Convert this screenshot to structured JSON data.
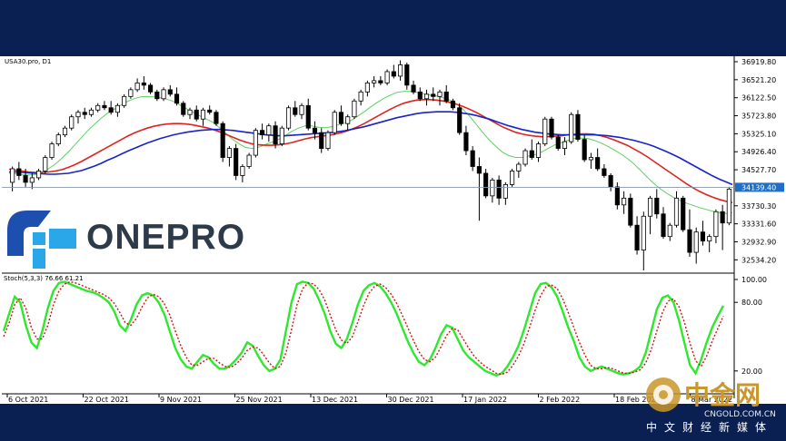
{
  "chart_data": {
    "type": "candlestick",
    "symbol_label": "USA30.pro, D1",
    "x_labels": [
      "6 Oct 2021",
      "22 Oct 2021",
      "9 Nov 2021",
      "25 Nov 2021",
      "13 Dec 2021",
      "30 Dec 2021",
      "17 Jan 2022",
      "2 Feb 2022",
      "18 Feb 2022",
      "8 Mar 2022"
    ],
    "y_ticks": [
      36919.8,
      36521.2,
      36122.5,
      35723.8,
      35325.1,
      34926.4,
      34527.7,
      33730.3,
      33331.6,
      32932.9,
      32534.2
    ],
    "current_price": "34139.40",
    "ylim": [
      32300,
      37000
    ],
    "candles": [
      [
        34250,
        34600,
        34050,
        34550
      ],
      [
        34550,
        34700,
        34300,
        34400
      ],
      [
        34400,
        34550,
        34150,
        34250
      ],
      [
        34250,
        34450,
        34100,
        34350
      ],
      [
        34350,
        34550,
        34300,
        34500
      ],
      [
        34500,
        34850,
        34450,
        34800
      ],
      [
        34800,
        35150,
        34750,
        35100
      ],
      [
        35100,
        35350,
        35050,
        35300
      ],
      [
        35300,
        35500,
        35250,
        35450
      ],
      [
        35450,
        35750,
        35400,
        35700
      ],
      [
        35700,
        35850,
        35550,
        35800
      ],
      [
        35800,
        35900,
        35650,
        35750
      ],
      [
        35750,
        35900,
        35700,
        35850
      ],
      [
        35850,
        36000,
        35800,
        35950
      ],
      [
        35950,
        36050,
        35850,
        35900
      ],
      [
        35900,
        36050,
        35750,
        35800
      ],
      [
        35800,
        36000,
        35700,
        35950
      ],
      [
        35950,
        36200,
        35900,
        36150
      ],
      [
        36150,
        36350,
        36100,
        36300
      ],
      [
        36300,
        36550,
        36250,
        36450
      ],
      [
        36450,
        36600,
        36300,
        36400
      ],
      [
        36400,
        36450,
        36200,
        36250
      ],
      [
        36250,
        36300,
        36050,
        36100
      ],
      [
        36100,
        36350,
        36050,
        36300
      ],
      [
        36300,
        36400,
        36150,
        36200
      ],
      [
        36200,
        36350,
        35950,
        36000
      ],
      [
        36000,
        36050,
        35700,
        35750
      ],
      [
        35750,
        35900,
        35650,
        35850
      ],
      [
        35850,
        35950,
        35600,
        35650
      ],
      [
        35650,
        35900,
        35500,
        35850
      ],
      [
        35850,
        35950,
        35750,
        35800
      ],
      [
        35800,
        35850,
        35500,
        35550
      ],
      [
        35550,
        35600,
        34700,
        34800
      ],
      [
        34800,
        35050,
        34600,
        35000
      ],
      [
        35000,
        35100,
        34300,
        34400
      ],
      [
        34400,
        34650,
        34250,
        34600
      ],
      [
        34600,
        34900,
        34550,
        34850
      ],
      [
        34850,
        35450,
        34800,
        35400
      ],
      [
        35400,
        35550,
        35200,
        35300
      ],
      [
        35300,
        35550,
        35150,
        35500
      ],
      [
        35500,
        35600,
        35000,
        35100
      ],
      [
        35100,
        35500,
        35050,
        35450
      ],
      [
        35450,
        35950,
        35400,
        35900
      ],
      [
        35900,
        36050,
        35700,
        35750
      ],
      [
        35750,
        36000,
        35650,
        35950
      ],
      [
        35950,
        36100,
        35400,
        35450
      ],
      [
        35450,
        35600,
        35200,
        35350
      ],
      [
        35350,
        35450,
        34900,
        35000
      ],
      [
        35000,
        35400,
        34950,
        35350
      ],
      [
        35350,
        35850,
        35300,
        35800
      ],
      [
        35800,
        35950,
        35500,
        35550
      ],
      [
        35550,
        35750,
        35400,
        35700
      ],
      [
        35700,
        36100,
        35650,
        36050
      ],
      [
        36050,
        36300,
        35950,
        36250
      ],
      [
        36250,
        36500,
        36150,
        36450
      ],
      [
        36450,
        36600,
        36350,
        36500
      ],
      [
        36500,
        36600,
        36400,
        36450
      ],
      [
        36450,
        36750,
        36400,
        36700
      ],
      [
        36700,
        36850,
        36550,
        36600
      ],
      [
        36600,
        36950,
        36500,
        36850
      ],
      [
        36850,
        36900,
        36300,
        36400
      ],
      [
        36400,
        36500,
        36200,
        36250
      ],
      [
        36250,
        36350,
        36050,
        36100
      ],
      [
        36100,
        36300,
        35950,
        36200
      ],
      [
        36200,
        36350,
        36050,
        36150
      ],
      [
        36150,
        36300,
        35950,
        36250
      ],
      [
        36250,
        36400,
        36000,
        36050
      ],
      [
        36050,
        36100,
        35850,
        35900
      ],
      [
        35900,
        36000,
        35300,
        35350
      ],
      [
        35350,
        35500,
        34850,
        34950
      ],
      [
        34950,
        35050,
        34500,
        34600
      ],
      [
        34600,
        34800,
        33400,
        34450
      ],
      [
        34450,
        34550,
        33900,
        33950
      ],
      [
        33950,
        34350,
        33800,
        34300
      ],
      [
        34300,
        34400,
        33750,
        33900
      ],
      [
        33900,
        34250,
        33750,
        34200
      ],
      [
        34200,
        34550,
        34150,
        34500
      ],
      [
        34500,
        34700,
        34350,
        34650
      ],
      [
        34650,
        35000,
        34600,
        34950
      ],
      [
        34950,
        35200,
        34750,
        34800
      ],
      [
        34800,
        35150,
        34700,
        35100
      ],
      [
        35100,
        35700,
        35050,
        35650
      ],
      [
        35650,
        35700,
        35200,
        35250
      ],
      [
        35250,
        35300,
        34950,
        35000
      ],
      [
        35000,
        35250,
        34850,
        35150
      ],
      [
        35150,
        35800,
        35100,
        35750
      ],
      [
        35750,
        35850,
        35150,
        35200
      ],
      [
        35200,
        35300,
        34700,
        34750
      ],
      [
        34750,
        34900,
        34550,
        34800
      ],
      [
        34800,
        35000,
        34500,
        34550
      ],
      [
        34550,
        34650,
        34350,
        34400
      ],
      [
        34400,
        34450,
        34050,
        34150
      ],
      [
        34150,
        34250,
        33650,
        33750
      ],
      [
        33750,
        34050,
        33550,
        33900
      ],
      [
        33900,
        34000,
        33250,
        33300
      ],
      [
        33300,
        33500,
        32650,
        32750
      ],
      [
        32750,
        33600,
        32300,
        33500
      ],
      [
        33500,
        33950,
        33100,
        33900
      ],
      [
        33900,
        34100,
        33450,
        33550
      ],
      [
        33550,
        33700,
        33000,
        33050
      ],
      [
        33050,
        33350,
        32950,
        33300
      ],
      [
        33300,
        34050,
        33250,
        33900
      ],
      [
        33900,
        33950,
        33150,
        33200
      ],
      [
        33200,
        33650,
        32600,
        32700
      ],
      [
        32700,
        33250,
        32450,
        33150
      ],
      [
        33150,
        33400,
        32850,
        32950
      ],
      [
        32950,
        33100,
        32700,
        33050
      ],
      [
        33050,
        33650,
        32900,
        33600
      ],
      [
        33600,
        33750,
        32750,
        33350
      ],
      [
        33350,
        34150,
        33300,
        34100
      ]
    ],
    "ma_green": [
      34450,
      34440,
      34420,
      34410,
      34420,
      34470,
      34550,
      34650,
      34780,
      34920,
      35080,
      35240,
      35400,
      35540,
      35670,
      35780,
      35870,
      35960,
      36040,
      36100,
      36140,
      36150,
      36140,
      36120,
      36090,
      36040,
      35960,
      35880,
      35800,
      35720,
      35650,
      35580,
      35460,
      35330,
      35200,
      35100,
      35020,
      35000,
      35030,
      35090,
      35140,
      35200,
      35280,
      35380,
      35450,
      35500,
      35500,
      35470,
      35460,
      35480,
      35520,
      35560,
      35620,
      35710,
      35810,
      35920,
      36020,
      36110,
      36180,
      36240,
      36260,
      36260,
      36240,
      36210,
      36180,
      36160,
      36120,
      36070,
      35990,
      35870,
      35720,
      35540,
      35360,
      35190,
      35050,
      34920,
      34840,
      34800,
      34800,
      34830,
      34860,
      34920,
      35000,
      35080,
      35130,
      35180,
      35220,
      35230,
      35220,
      35180,
      35120,
      35050,
      34970,
      34880,
      34780,
      34660,
      34520,
      34370,
      34230,
      34110,
      34010,
      33920,
      33850,
      33790,
      33740,
      33690,
      33650,
      33610,
      33580,
      33560,
      33580
    ],
    "ma_red": [
      34540,
      34520,
      34500,
      34480,
      34470,
      34470,
      34480,
      34500,
      34530,
      34580,
      34640,
      34710,
      34790,
      34870,
      34950,
      35030,
      35110,
      35190,
      35270,
      35340,
      35400,
      35450,
      35490,
      35520,
      35540,
      35550,
      35550,
      35540,
      35520,
      35490,
      35460,
      35420,
      35370,
      35310,
      35250,
      35190,
      35140,
      35100,
      35080,
      35070,
      35070,
      35080,
      35100,
      35130,
      35170,
      35210,
      35240,
      35260,
      35280,
      35300,
      35330,
      35370,
      35420,
      35480,
      35550,
      35630,
      35710,
      35790,
      35870,
      35940,
      36000,
      36040,
      36070,
      36080,
      36080,
      36070,
      36050,
      36020,
      35980,
      35930,
      35870,
      35800,
      35720,
      35640,
      35560,
      35480,
      35420,
      35360,
      35320,
      35290,
      35270,
      35260,
      35260,
      35270,
      35280,
      35300,
      35310,
      35320,
      35320,
      35310,
      35280,
      35240,
      35190,
      35130,
      35070,
      34990,
      34910,
      34820,
      34720,
      34620,
      34520,
      34420,
      34320,
      34220,
      34130,
      34050,
      33980,
      33920,
      33870,
      33830,
      33800
    ],
    "ma_blue": [
      34480,
      34480,
      34470,
      34460,
      34450,
      34440,
      34430,
      34430,
      34440,
      34450,
      34480,
      34510,
      34560,
      34610,
      34670,
      34740,
      34800,
      34870,
      34940,
      35000,
      35060,
      35120,
      35170,
      35220,
      35260,
      35300,
      35330,
      35360,
      35380,
      35400,
      35410,
      35420,
      35420,
      35410,
      35400,
      35380,
      35360,
      35340,
      35320,
      35300,
      35290,
      35280,
      35280,
      35290,
      35300,
      35310,
      35320,
      35330,
      35340,
      35350,
      35370,
      35390,
      35420,
      35450,
      35480,
      35520,
      35560,
      35600,
      35640,
      35680,
      35710,
      35740,
      35770,
      35790,
      35800,
      35810,
      35810,
      35810,
      35800,
      35780,
      35760,
      35730,
      35690,
      35650,
      35600,
      35550,
      35500,
      35460,
      35420,
      35390,
      35360,
      35340,
      35320,
      35310,
      35300,
      35300,
      35300,
      35300,
      35300,
      35300,
      35290,
      35280,
      35260,
      35240,
      35210,
      35180,
      35140,
      35100,
      35050,
      34990,
      34930,
      34860,
      34790,
      34710,
      34630,
      34550,
      34470,
      34390,
      34320,
      34260,
      34200
    ],
    "stochastic": {
      "label": "Stoch(5,3,3) 76.66 61.21",
      "y_ticks": [
        100,
        80,
        20
      ],
      "k_last": 76.66,
      "d_last": 61.21,
      "k": [
        55,
        70,
        85,
        80,
        60,
        45,
        40,
        55,
        75,
        90,
        97,
        98,
        96,
        94,
        92,
        90,
        89,
        87,
        84,
        80,
        72,
        60,
        55,
        65,
        78,
        86,
        88,
        86,
        80,
        70,
        55,
        40,
        30,
        24,
        22,
        28,
        34,
        32,
        26,
        22,
        22,
        25,
        30,
        36,
        45,
        42,
        33,
        25,
        20,
        22,
        30,
        55,
        80,
        96,
        98,
        97,
        92,
        82,
        70,
        55,
        44,
        40,
        48,
        62,
        78,
        90,
        95,
        97,
        94,
        88,
        80,
        70,
        58,
        46,
        36,
        28,
        25,
        30,
        40,
        52,
        60,
        58,
        48,
        38,
        32,
        28,
        24,
        20,
        18,
        16,
        18,
        24,
        32,
        42,
        56,
        72,
        88,
        96,
        97,
        93,
        85,
        72,
        58,
        46,
        32,
        24,
        20,
        22,
        24,
        22,
        20,
        18,
        17,
        18,
        20,
        24,
        36,
        55,
        74,
        84,
        86,
        80,
        64,
        44,
        25,
        18,
        30,
        45,
        58,
        68,
        77
      ],
      "d": [
        50,
        62,
        78,
        84,
        75,
        58,
        48,
        48,
        60,
        78,
        90,
        96,
        98,
        97,
        95,
        93,
        91,
        89,
        87,
        84,
        79,
        71,
        62,
        60,
        66,
        76,
        84,
        87,
        85,
        79,
        69,
        55,
        42,
        32,
        25,
        25,
        28,
        31,
        31,
        27,
        24,
        23,
        26,
        31,
        38,
        41,
        40,
        34,
        27,
        22,
        24,
        36,
        56,
        78,
        92,
        97,
        96,
        91,
        82,
        69,
        56,
        47,
        44,
        50,
        63,
        77,
        88,
        94,
        96,
        93,
        87,
        79,
        69,
        58,
        47,
        37,
        30,
        28,
        32,
        41,
        51,
        57,
        56,
        48,
        40,
        33,
        28,
        24,
        21,
        18,
        17,
        19,
        25,
        33,
        44,
        58,
        73,
        86,
        94,
        95,
        92,
        83,
        71,
        58,
        45,
        34,
        25,
        22,
        22,
        23,
        22,
        20,
        18,
        18,
        19,
        21,
        27,
        39,
        55,
        71,
        81,
        83,
        76,
        62,
        44,
        29,
        24,
        33,
        46,
        57,
        68
      ]
    }
  },
  "branding": {
    "logo_text": "ONEPRO",
    "watermark_cn": "中金网",
    "watermark_url": "CNGOLD.COM.CN",
    "watermark_sub": "中文财经新媒体"
  },
  "colors": {
    "background": "#0a1f52",
    "candle": "#000000",
    "ma_green": "#5ed05e",
    "ma_red": "#e0231c",
    "ma_blue": "#1624c9",
    "stoch_k": "#2ee82e",
    "stoch_d": "#d01212",
    "price_line": "#8a98ad",
    "price_label_bg": "#1f6fc6",
    "logo_text": "#2d3a4a",
    "logo_blue": "#1d4fae",
    "logo_cyan": "#2aa7e8"
  }
}
